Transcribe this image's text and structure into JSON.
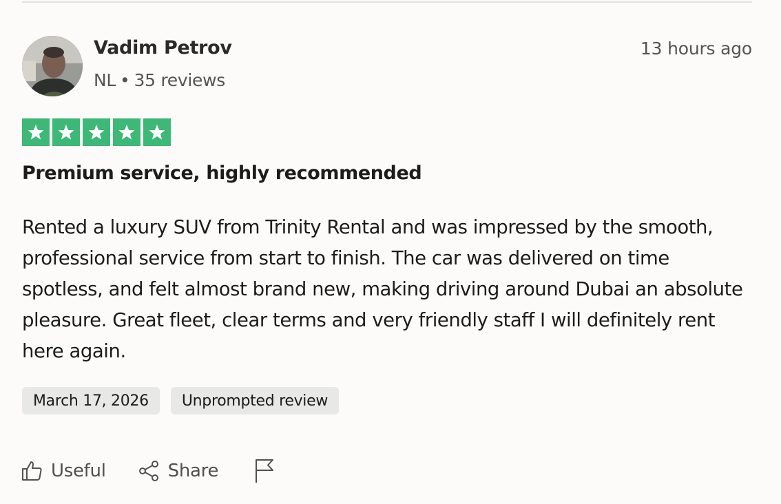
{
  "reviewer": {
    "name": "Vadim Petrov",
    "country": "NL",
    "separator": "•",
    "review_count": "35 reviews"
  },
  "posted_ago": "13 hours ago",
  "rating": {
    "value": 5,
    "max": 5,
    "color": "#3db877"
  },
  "review": {
    "title": "Premium service, highly recommended",
    "text": "Rented a luxury SUV from Trinity Rental and was impressed by the smooth, professional service from start to finish. The car was delivered on time spotless, and felt almost brand new, making driving around Dubai an absolute pleasure. Great fleet, clear terms and very friendly staff I will definitely rent here again."
  },
  "tags": [
    "March 17, 2026",
    "Unprompted review"
  ],
  "actions": {
    "useful_label": "Useful",
    "share_label": "Share",
    "useful_icon": "thumbs-up-icon",
    "share_icon": "share-icon",
    "report_icon": "flag-icon"
  }
}
